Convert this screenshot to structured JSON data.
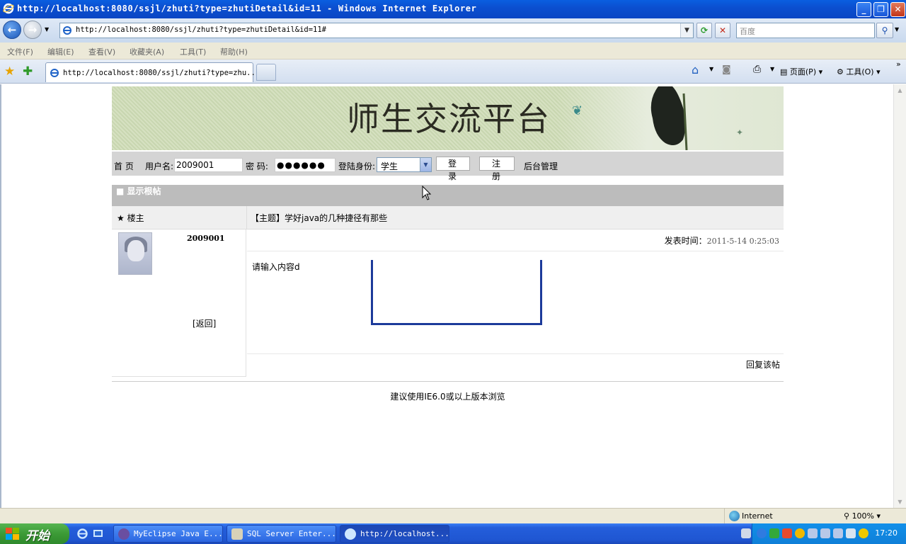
{
  "window": {
    "title": "http://localhost:8080/ssjl/zhuti?type=zhutiDetail&id=11 - Windows Internet Explorer",
    "url": "http://localhost:8080/ssjl/zhuti?type=zhutiDetail&id=11#",
    "search_placeholder": "百度"
  },
  "menu": [
    "文件(F)",
    "编辑(E)",
    "查看(V)",
    "收藏夹(A)",
    "工具(T)",
    "帮助(H)"
  ],
  "tab": {
    "label": "http://localhost:8080/ssjl/zhuti?type=zhu..."
  },
  "command_bar": {
    "page": "页面(P)",
    "tools": "工具(O)"
  },
  "site": {
    "title": "师生交流平台",
    "nav": {
      "home": "首 页",
      "username_label": "用户名:",
      "username_value": "2009001",
      "password_label": "密  码:",
      "password_value": "●●●●●●",
      "role_label": "登陆身份:",
      "role_value": "学生",
      "login_button": "登 录",
      "register_button": "注 册",
      "admin_link": "后台管理"
    },
    "panel": {
      "header": "■ 显示根帖",
      "owner_label": "楼主",
      "subject": "【主题】学好java的几种捷径有那些",
      "username": "2009001",
      "back_link": "[返回]",
      "time_label": "发表时间：",
      "time_value": "2011-5-14 0:25:03",
      "content": "请输入内容d",
      "reply_link": "回复该帖"
    },
    "footer": "建议使用IE6.0或以上版本浏览"
  },
  "status": {
    "zone": "Internet",
    "zoom": "100%"
  },
  "taskbar": {
    "start": "开始",
    "items": [
      "MyEclipse Java E...",
      "SQL Server Enter...",
      "http://localhost..."
    ],
    "clock": "17:20"
  }
}
